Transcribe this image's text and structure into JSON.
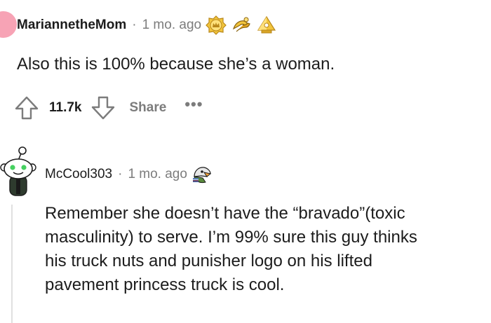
{
  "comment_1": {
    "username": "MariannetheMom",
    "separator": "·",
    "timestamp": "1 mo. ago",
    "awards": [
      "crown-award-icon",
      "helping-hand-award-icon",
      "gold-pyramid-award-icon"
    ],
    "avatar_color": "#f7a3b5",
    "body": "Also this is 100% because she’s a woman.",
    "score": "11.7k",
    "share_label": "Share",
    "more_label": "•••"
  },
  "comment_2": {
    "username": "McCool303",
    "separator": "·",
    "timestamp": "1 mo. ago",
    "awards": [
      "eagle-award-icon"
    ],
    "body_lines": [
      "Remember she doesn’t have the “bravado”(toxic",
      "masculinity) to serve. I’m 99% sure this guy thinks",
      "his truck nuts and punisher logo on his lifted",
      "pavement princess truck is cool."
    ]
  },
  "colors": {
    "text": "#1c1c1c",
    "meta": "#7c7c7c",
    "thread_line": "#e0e0e0",
    "award_gold": "#e8b92c"
  }
}
